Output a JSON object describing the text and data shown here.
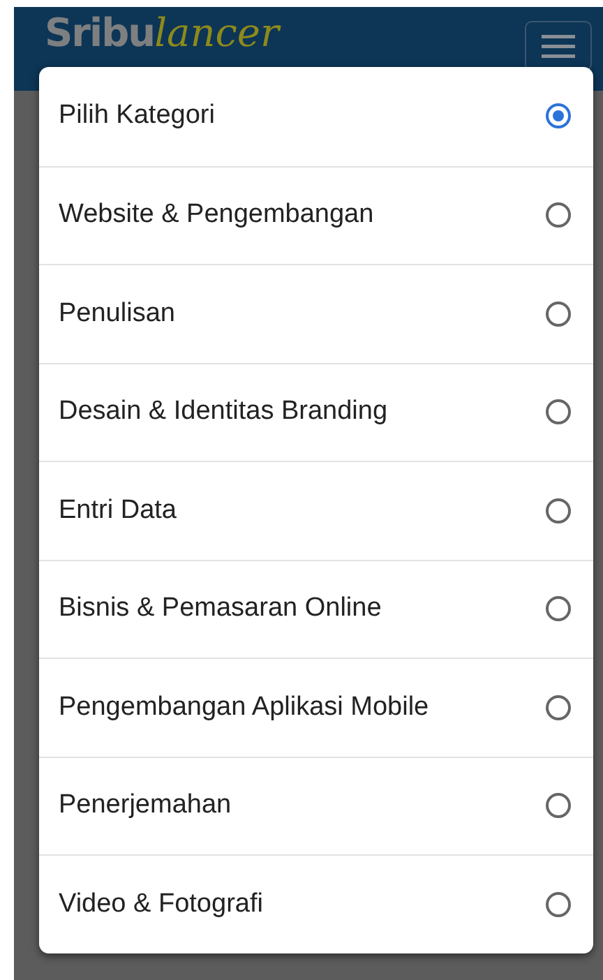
{
  "header": {
    "logo": {
      "part_1": "Sribu",
      "part_2": "lancer"
    }
  },
  "dialog": {
    "options": [
      {
        "label": "Pilih Kategori",
        "selected": true
      },
      {
        "label": "Website & Pengembangan",
        "selected": false
      },
      {
        "label": "Penulisan",
        "selected": false
      },
      {
        "label": "Desain & Identitas Branding",
        "selected": false
      },
      {
        "label": "Entri Data",
        "selected": false
      },
      {
        "label": "Bisnis & Pemasaran Online",
        "selected": false
      },
      {
        "label": "Pengembangan Aplikasi Mobile",
        "selected": false
      },
      {
        "label": "Penerjemahan",
        "selected": false
      },
      {
        "label": "Video & Fotografi",
        "selected": false
      }
    ]
  }
}
